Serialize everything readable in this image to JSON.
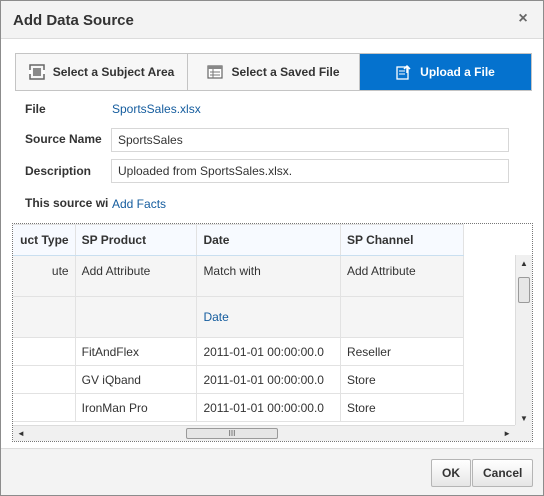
{
  "dialog": {
    "title": "Add Data Source",
    "close_glyph": "×"
  },
  "tabs": [
    {
      "label": "Select a Subject Area",
      "icon": "subject-area-icon",
      "active": false
    },
    {
      "label": "Select a Saved File",
      "icon": "saved-file-icon",
      "active": false
    },
    {
      "label": "Upload a File",
      "icon": "upload-file-icon",
      "active": true
    }
  ],
  "form": {
    "file_label": "File",
    "file_value": "SportsSales.xlsx",
    "source_name_label": "Source Name",
    "source_name_value": "SportsSales",
    "description_label": "Description",
    "description_value": "Uploaded from SportsSales.xlsx.",
    "source_type_label": "This source wi",
    "source_type_link": "Add Facts"
  },
  "grid": {
    "columns": [
      "uct Type",
      "SP Product",
      "Date",
      "SP Channel"
    ],
    "mapping_row": [
      "ute",
      "Add Attribute",
      "Match with",
      "Add Attribute"
    ],
    "match_row": [
      "",
      "",
      "Date",
      ""
    ],
    "rows": [
      [
        "",
        "FitAndFlex",
        "2011-01-01 00:00:00.0",
        "Reseller"
      ],
      [
        "",
        "GV iQband",
        "2011-01-01 00:00:00.0",
        "Store"
      ],
      [
        "",
        "IronMan Pro",
        "2011-01-01 00:00:00.0",
        "Store"
      ]
    ]
  },
  "scroll": {
    "up_glyph": "▲",
    "down_glyph": "▼",
    "left_glyph": "◄",
    "right_glyph": "►",
    "grip_glyph": "III"
  },
  "footer": {
    "ok_label": "OK",
    "cancel_label": "Cancel"
  },
  "colors": {
    "accent": "#0572ce",
    "link": "#145c9e"
  }
}
